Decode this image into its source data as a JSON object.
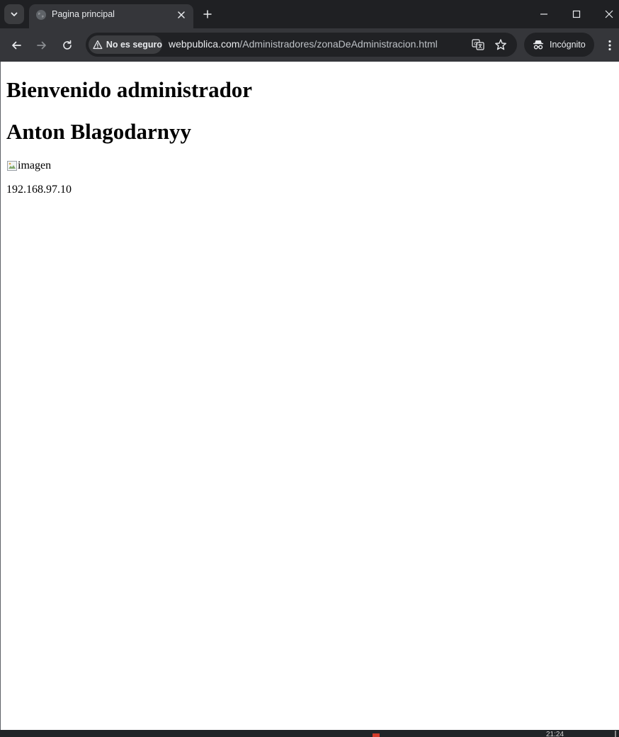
{
  "window": {
    "tab_title": "Pagina principal"
  },
  "omnibox": {
    "security_label": "No es seguro",
    "url_host": "webpublica.com",
    "url_path": "/Administradores/zonaDeAdministracion.html"
  },
  "profile": {
    "incognito_label": "Incógnito"
  },
  "page": {
    "heading_welcome": "Bienvenido administrador",
    "heading_name": "Anton Blagodarnyy",
    "image_alt": "imagen",
    "ip_address": "192.168.97.10"
  },
  "taskbar": {
    "clock": "21:24"
  },
  "icons": {
    "tab_favicon": "globe-icon",
    "security": "warning-triangle-icon",
    "translate": "translate-icon",
    "bookmark": "star-icon",
    "incognito": "incognito-icon"
  },
  "colors": {
    "chrome_dark": "#1f2023",
    "toolbar": "#35363a",
    "omnibox": "#202124",
    "page_background": "#ffffff"
  }
}
